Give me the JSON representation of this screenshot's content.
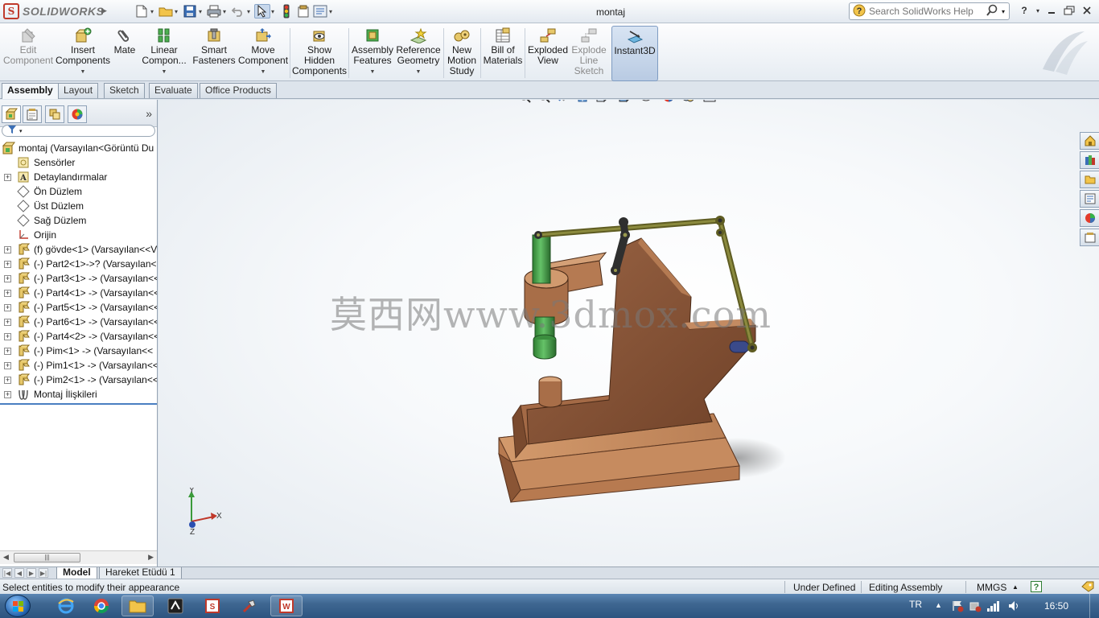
{
  "app": {
    "name": "SOLIDWORKS",
    "document_title": "montaj"
  },
  "help_search": {
    "placeholder": "Search SolidWorks Help"
  },
  "command_manager": {
    "edit_component": [
      "Edit",
      "Component"
    ],
    "insert_components": [
      "Insert",
      "Components"
    ],
    "mate": [
      "Mate"
    ],
    "linear_component": [
      "Linear",
      "Compon..."
    ],
    "smart_fasteners": [
      "Smart",
      "Fasteners"
    ],
    "move_component": [
      "Move",
      "Component"
    ],
    "show_hidden": [
      "Show",
      "Hidden",
      "Components"
    ],
    "assembly_features": [
      "Assembly",
      "Features"
    ],
    "reference_geometry": [
      "Reference",
      "Geometry"
    ],
    "new_motion_study": [
      "New",
      "Motion",
      "Study"
    ],
    "bill_of_materials": [
      "Bill of",
      "Materials"
    ],
    "exploded_view": [
      "Exploded",
      "View"
    ],
    "explode_line_sketch": [
      "Explode",
      "Line",
      "Sketch"
    ],
    "instant3d": [
      "Instant3D"
    ]
  },
  "tabs": [
    "Assembly",
    "Layout",
    "Sketch",
    "Evaluate",
    "Office Products"
  ],
  "tree": {
    "root": "montaj  (Varsayılan<Görüntü Du",
    "items": [
      {
        "label": "Sensörler",
        "icon": "sensor-icon",
        "expand": false
      },
      {
        "label": "Detaylandırmalar",
        "icon": "annotation-icon",
        "expand": true
      },
      {
        "label": "Ön Düzlem",
        "icon": "plane-icon",
        "expand": false
      },
      {
        "label": "Üst Düzlem",
        "icon": "plane-icon",
        "expand": false
      },
      {
        "label": "Sağ Düzlem",
        "icon": "plane-icon",
        "expand": false
      },
      {
        "label": "Orijin",
        "icon": "origin-icon",
        "expand": false
      },
      {
        "label": "(f) gövde<1> (Varsayılan<<V",
        "icon": "part-icon",
        "expand": true
      },
      {
        "label": "(-) Part2<1>->? (Varsayılan<",
        "icon": "part-icon",
        "expand": true
      },
      {
        "label": "(-) Part3<1> -> (Varsayılan<<",
        "icon": "part-icon",
        "expand": true
      },
      {
        "label": "(-) Part4<1> -> (Varsayılan<<",
        "icon": "part-icon",
        "expand": true
      },
      {
        "label": "(-) Part5<1> -> (Varsayılan<<",
        "icon": "part-icon",
        "expand": true
      },
      {
        "label": "(-) Part6<1> -> (Varsayılan<<",
        "icon": "part-icon",
        "expand": true
      },
      {
        "label": "(-) Part4<2> -> (Varsayılan<<",
        "icon": "part-icon",
        "expand": true
      },
      {
        "label": "(-) Pim<1> -> (Varsayılan<<",
        "icon": "part-icon",
        "expand": true
      },
      {
        "label": "(-) Pim1<1> -> (Varsayılan<<",
        "icon": "part-icon",
        "expand": true
      },
      {
        "label": "(-) Pim2<1> -> (Varsayılan<<",
        "icon": "part-icon",
        "expand": true
      },
      {
        "label": "Montaj İlişkileri",
        "icon": "mates-icon",
        "expand": true
      }
    ]
  },
  "watermark": "莫西网www.3dmox.com",
  "triad": {
    "x": "X",
    "y": "Y",
    "z": "Z"
  },
  "bottom_tabs": [
    "Model",
    "Hareket Etüdü 1"
  ],
  "status": {
    "message": "Select entities to modify their appearance",
    "definition": "Under Defined",
    "mode": "Editing Assembly",
    "units": "MMGS"
  },
  "taskbar": {
    "language": "TR",
    "clock": "16:50"
  },
  "colors": {
    "body": "#8b5a3c",
    "body_light": "#c98f62",
    "link": "#6c6b2a",
    "green": "#3f9a3f",
    "accent": "#4a7fc1"
  }
}
